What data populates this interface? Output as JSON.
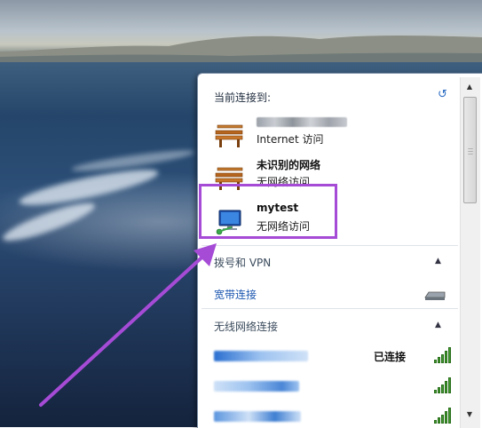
{
  "colors": {
    "accent_purple": "#a54bd6",
    "link_blue": "#1a56b0",
    "signal_green": "#3e9b2c"
  },
  "panel": {
    "current_header": "当前连接到:",
    "refresh_icon": "refresh-icon",
    "connections": [
      {
        "name": "",
        "status": "Internet 访问",
        "icon": "bench-network-icon"
      },
      {
        "name": "未识别的网络",
        "status": "无网络访问",
        "icon": "bench-network-icon"
      },
      {
        "name": "mytest",
        "status": "无网络访问",
        "icon": "computer-network-icon"
      }
    ],
    "dialup_title": "拨号和 VPN",
    "broadband_link": "宽带连接",
    "wireless_title": "无线网络连接",
    "wifi": [
      {
        "state": "已连接",
        "signal_bars": 5
      },
      {
        "state": "",
        "signal_bars": 5
      },
      {
        "state": "",
        "signal_bars": 5
      }
    ]
  }
}
